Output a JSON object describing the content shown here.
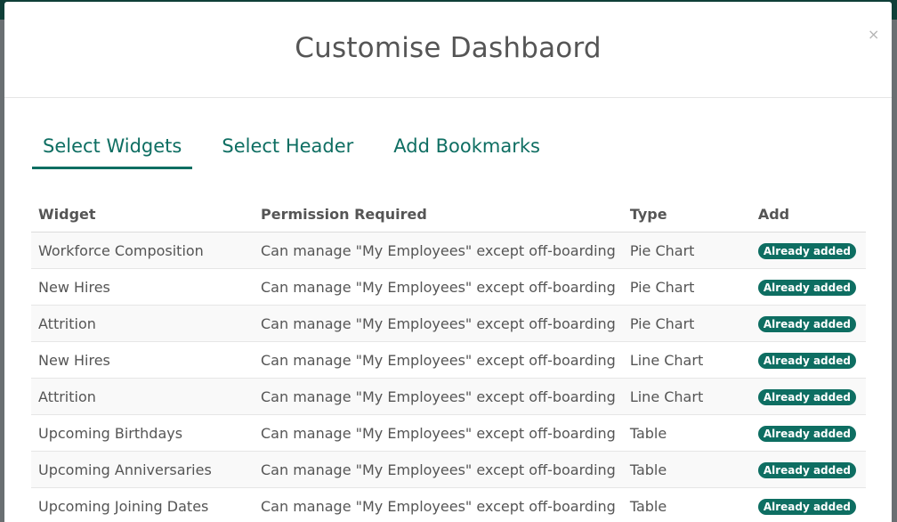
{
  "modal": {
    "title": "Customise Dashbaord",
    "close_label": "×"
  },
  "tabs": [
    {
      "label": "Select Widgets",
      "active": true
    },
    {
      "label": "Select Header",
      "active": false
    },
    {
      "label": "Add Bookmarks",
      "active": false
    }
  ],
  "table": {
    "headers": {
      "widget": "Widget",
      "permission": "Permission Required",
      "type": "Type",
      "add": "Add"
    },
    "rows": [
      {
        "widget": "Workforce Composition",
        "permission": "Can manage \"My Employees\" except off-boarding",
        "type": "Pie Chart",
        "status": "Already added"
      },
      {
        "widget": "New Hires",
        "permission": "Can manage \"My Employees\" except off-boarding",
        "type": "Pie Chart",
        "status": "Already added"
      },
      {
        "widget": "Attrition",
        "permission": "Can manage \"My Employees\" except off-boarding",
        "type": "Pie Chart",
        "status": "Already added"
      },
      {
        "widget": "New Hires",
        "permission": "Can manage \"My Employees\" except off-boarding",
        "type": "Line Chart",
        "status": "Already added"
      },
      {
        "widget": "Attrition",
        "permission": "Can manage \"My Employees\" except off-boarding",
        "type": "Line Chart",
        "status": "Already added"
      },
      {
        "widget": "Upcoming Birthdays",
        "permission": "Can manage \"My Employees\" except off-boarding",
        "type": "Table",
        "status": "Already added"
      },
      {
        "widget": "Upcoming Anniversaries",
        "permission": "Can manage \"My Employees\" except off-boarding",
        "type": "Table",
        "status": "Already added"
      },
      {
        "widget": "Upcoming Joining Dates",
        "permission": "Can manage \"My Employees\" except off-boarding",
        "type": "Table",
        "status": "Already added"
      }
    ]
  },
  "colors": {
    "accent": "#0e6e62",
    "overlay": "#5f6467",
    "topbar": "#0f3f38"
  }
}
